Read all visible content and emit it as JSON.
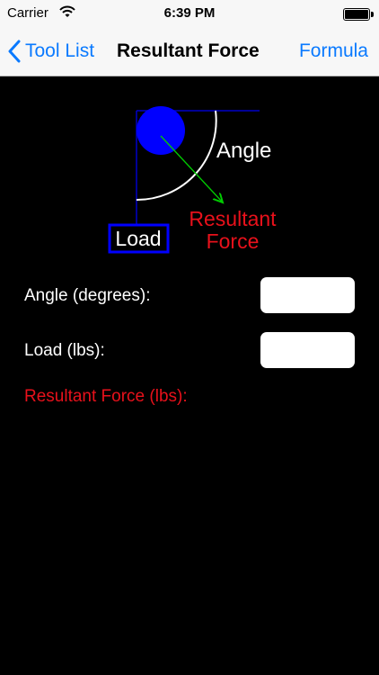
{
  "status_bar": {
    "carrier": "Carrier",
    "time": "6:39 PM"
  },
  "nav": {
    "back_label": "Tool List",
    "title": "Resultant Force",
    "right_label": "Formula"
  },
  "diagram": {
    "angle_label": "Angle",
    "load_label": "Load",
    "resultant_line1": "Resultant",
    "resultant_line2": "Force",
    "colors": {
      "ball": "#0000ff",
      "lines": "#0000c8",
      "arc": "#ffffff",
      "arrow": "#00cc00",
      "resultant": "#e8111b"
    }
  },
  "form": {
    "angle_label": "Angle (degrees):",
    "angle_value": "",
    "load_label": "Load (lbs):",
    "load_value": "",
    "result_label": "Resultant Force (lbs):"
  },
  "colors": {
    "accent": "#0a7aff",
    "background": "#000000",
    "result_text": "#e8111b"
  }
}
